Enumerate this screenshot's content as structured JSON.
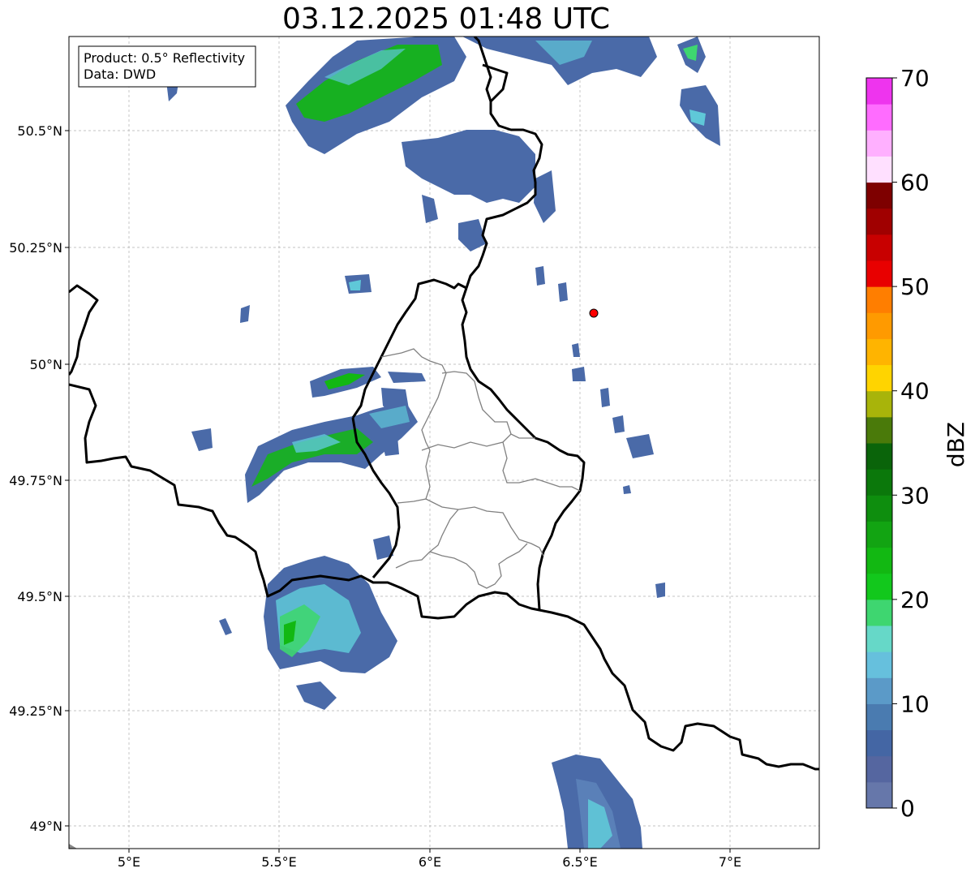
{
  "title": "03.12.2025 01:48 UTC",
  "info_box": {
    "product_line": "Product: 0.5° Reflectivity",
    "data_line": "Data: DWD"
  },
  "axes": {
    "lat_labels": [
      "50.5°N",
      "50.25°N",
      "50°N",
      "49.75°N",
      "49.5°N",
      "49.25°N",
      "49°N"
    ],
    "lon_labels": [
      "5°E",
      "5.5°E",
      "6°E",
      "6.5°E",
      "7°E"
    ]
  },
  "radar_site": {
    "color": "#ff0000",
    "lat": 50.11,
    "lon": 6.55
  },
  "colorbar": {
    "label": "dBZ",
    "ticks": [
      "0",
      "10",
      "20",
      "30",
      "40",
      "50",
      "60",
      "70"
    ],
    "step_dbz": 2.5,
    "colors": [
      "#6677aa",
      "#5566a0",
      "#4466a4",
      "#4a7bb0",
      "#5b9ac8",
      "#66c0dd",
      "#66d8c8",
      "#3ed670",
      "#12c81c",
      "#12b812",
      "#12a412",
      "#0e8e0e",
      "#0b780b",
      "#0a640a",
      "#4a7a0a",
      "#a8b40a",
      "#ffd400",
      "#ffb400",
      "#ff9a00",
      "#ff7e00",
      "#e80000",
      "#c80000",
      "#a00000",
      "#7e0000",
      "#ffe0ff",
      "#ffb0ff",
      "#ff6cff",
      "#ee34ee"
    ]
  },
  "legend": {
    "reflectivity_colors": {
      "light": "#4a6aa8",
      "medium": "#5fc8d8",
      "strong": "#10b020"
    }
  }
}
